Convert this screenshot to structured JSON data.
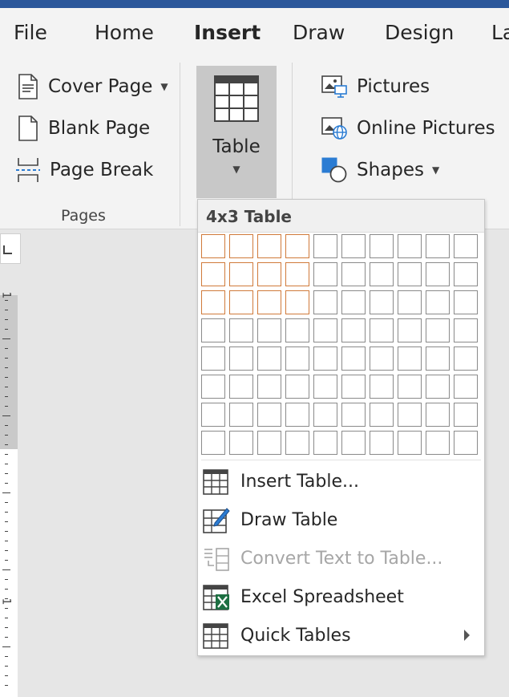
{
  "tabs": [
    "File",
    "Home",
    "Insert",
    "Draw",
    "Design",
    "La"
  ],
  "active_tab": "Insert",
  "pages_group": {
    "label": "Pages",
    "cover_page": "Cover Page",
    "blank_page": "Blank Page",
    "page_break": "Page Break"
  },
  "table_button": {
    "label": "Table"
  },
  "illustrations": {
    "pictures": "Pictures",
    "online_pictures": "Online Pictures",
    "shapes": "Shapes"
  },
  "table_dropdown": {
    "title": "4x3 Table",
    "grid": {
      "columns": 10,
      "rows": 8,
      "selected_columns": 4,
      "selected_rows": 3
    },
    "items": [
      {
        "label": "Insert Table...",
        "icon": "insert-table-icon",
        "enabled": true,
        "submenu": false
      },
      {
        "label": "Draw Table",
        "icon": "draw-table-icon",
        "enabled": true,
        "submenu": false
      },
      {
        "label": "Convert Text to Table...",
        "icon": "convert-text-icon",
        "enabled": false,
        "submenu": false
      },
      {
        "label": "Excel Spreadsheet",
        "icon": "excel-spreadsheet-icon",
        "enabled": true,
        "submenu": false
      },
      {
        "label": "Quick Tables",
        "icon": "quick-tables-icon",
        "enabled": true,
        "submenu": true
      }
    ]
  },
  "ruler": {
    "labels": [
      "1",
      "1"
    ]
  },
  "colors": {
    "accent": "#2b579a",
    "selection": "#d07a3a",
    "ribbon": "#f3f3f3",
    "excel_green": "#1d6f42"
  }
}
